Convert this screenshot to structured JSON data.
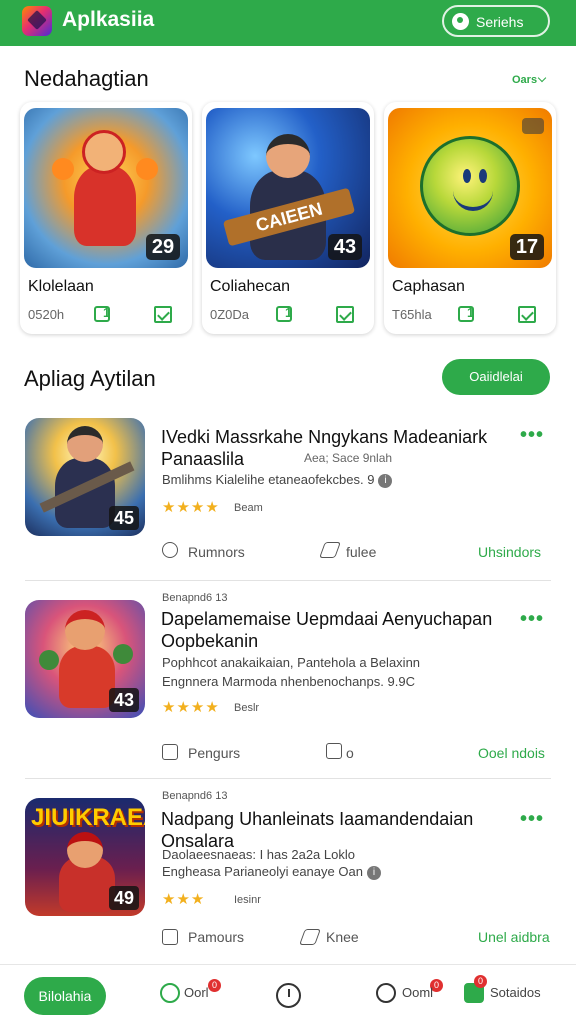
{
  "header": {
    "app_title": "Aplkasiia",
    "search_label": "Seriehs"
  },
  "featured": {
    "title": "Nedahagtian",
    "more_label": "Oars",
    "cards": [
      {
        "name": "Klolelaan",
        "meta": "0520h",
        "badge": "29",
        "icon": "trophy-icon"
      },
      {
        "name": "Coliahecan",
        "meta": "0Z0Da",
        "badge": "43",
        "art_text": "CAIEEN",
        "icon": "trophy-icon"
      },
      {
        "name": "Caphasan",
        "meta": "T65hla",
        "badge": "17",
        "icon": "trophy-icon"
      }
    ]
  },
  "list": {
    "title": "Apliag Aytilan",
    "action_label": "Oaiidlelai",
    "items": [
      {
        "kicker": "",
        "title": "IVedki Massrkahe Nngykans Madeaniark Panaaslila",
        "title_tail": "Aea; Sace 9nlah",
        "desc": "Bmlihms Kialelihe etaneaofekcbes. 9",
        "badge": "45",
        "rating_text": "Beam",
        "stars": [
          1,
          1,
          1,
          0.5,
          0
        ],
        "actions": [
          "Rumnors",
          "fulee",
          "Uhsindors"
        ]
      },
      {
        "kicker": "Benapnd6 13",
        "title": "Dapelamemaise Uepmdaai Aenyuchapan Oopbekanin",
        "desc1": "Pophhcot anakaikaian, Pantehola a Belaxinn",
        "desc2": "Engnnera Marmoda nhenbenochanps. 9.9C",
        "badge": "43",
        "rating_text": "Beslr",
        "stars": [
          1,
          1,
          1,
          0.5,
          0
        ],
        "actions": [
          "Pengurs",
          "o",
          "Ooel ndois"
        ]
      },
      {
        "kicker": "Benapnd6 13",
        "title": "Nadpang Uhanleinats Iaamandendaian Onsalara",
        "desc1": "Daolaeesnaeas: I has 2a2a Loklo",
        "desc2": "Engheasa Parianeolyi eanaye Oan",
        "badge": "49",
        "art_text": "JIUIKRAEA",
        "rating_text": "Iesinr",
        "stars": [
          1,
          1,
          1,
          0,
          0
        ],
        "actions": [
          "Pamours",
          "Knee",
          "Unel aidbra"
        ]
      }
    ]
  },
  "bottom_nav": {
    "home": "Bilolahia",
    "nav1": "Oorl",
    "nav1_badge": "0",
    "nav3": "Ooml",
    "nav3_badge": "0",
    "nav4": "Sotaidos",
    "nav4_badge": "0"
  },
  "colors": {
    "accent": "#2eaa4a",
    "header": "#2eaa4a",
    "star": "#f2b01e"
  }
}
